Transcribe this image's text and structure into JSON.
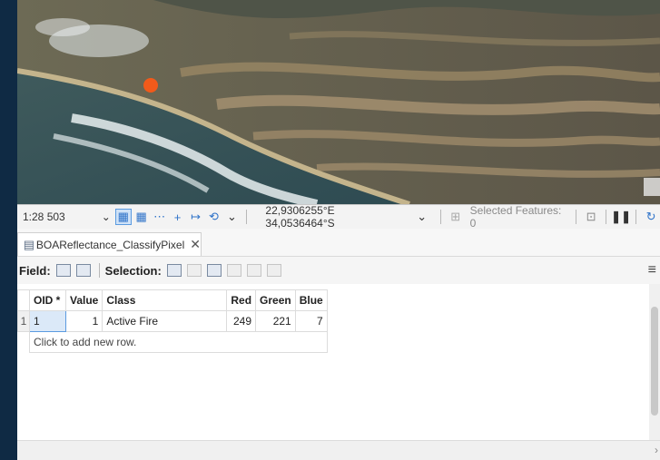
{
  "statusbar": {
    "scale": "1:28 503",
    "coordinates": "22,9306255°E 34,0536464°S",
    "selected_features": "Selected Features: 0"
  },
  "tab": {
    "title": "BOAReflectance_ClassifyPixel",
    "close": "✕"
  },
  "toolbar": {
    "field_label": "Field:",
    "selection_label": "Selection:"
  },
  "table": {
    "columns": [
      "OID *",
      "Value",
      "Class",
      "Red",
      "Green",
      "Blue"
    ],
    "rows": [
      {
        "row_number": "1",
        "oid": "1",
        "value": "1",
        "class": "Active Fire",
        "red": "249",
        "green": "221",
        "blue": "7"
      }
    ],
    "add_row_text": "Click to add new row."
  },
  "colors": {
    "active_fire": "#f25a1a",
    "selection_blue": "#2f73c9"
  }
}
